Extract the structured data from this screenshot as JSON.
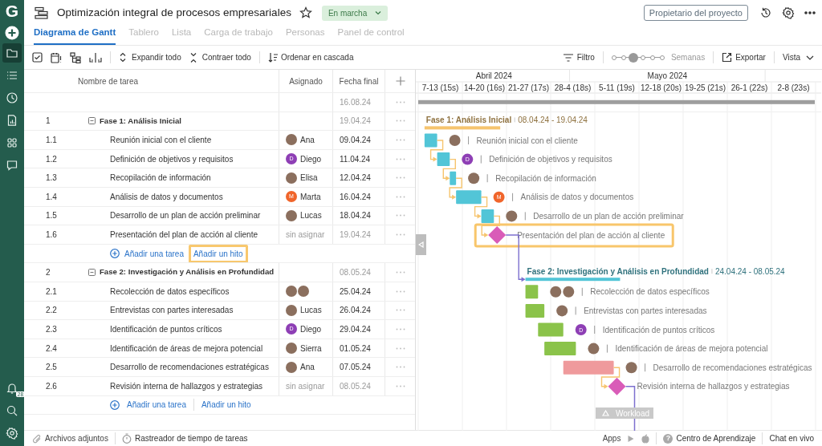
{
  "sidebar": {
    "logo": "G",
    "items": [
      {
        "kind": "folder",
        "selected": true
      },
      {
        "kind": "list",
        "selected": false
      },
      {
        "kind": "clock",
        "selected": false
      },
      {
        "kind": "report",
        "selected": false
      },
      {
        "kind": "grid",
        "selected": false
      },
      {
        "kind": "chat",
        "selected": false
      }
    ],
    "notification_count": "28"
  },
  "project": {
    "title": "Optimización integral de procesos empresariales",
    "starred": false,
    "status": "En marcha",
    "owner_button": "Propietario del proyecto"
  },
  "tabs": [
    {
      "label": "Diagrama de Gantt",
      "selected": true
    },
    {
      "label": "Tablero",
      "selected": false
    },
    {
      "label": "Lista",
      "selected": false
    },
    {
      "label": "Carga de trabajo",
      "selected": false
    },
    {
      "label": "Personas",
      "selected": false
    },
    {
      "label": "Panel de control",
      "selected": false
    }
  ],
  "toolbar": {
    "actions": [
      {
        "kind": "expand",
        "label": "Expandir todo"
      },
      {
        "kind": "collapse",
        "label": "Contraer todo"
      },
      {
        "kind": "sort",
        "label": "Ordenar en cascada"
      }
    ],
    "filter": "Filtro",
    "zoom": {
      "level": 0.4,
      "label": "Semanas"
    },
    "export": "Exportar",
    "view": "Vista"
  },
  "table": {
    "columns": [
      "Nombre de tarea",
      "Asignado",
      "Fecha final"
    ],
    "rows": [
      {
        "kind": "total",
        "due": "16.08.24"
      },
      {
        "kind": "phase",
        "number": "1",
        "name": "Fase 1: Análisis Inicial",
        "expanded": true,
        "due": "19.04.24"
      },
      {
        "kind": "task",
        "number": "1.1",
        "name": "Reunión inicial con el cliente",
        "assignees": [
          {
            "kind": "photo",
            "name": "Ana"
          }
        ],
        "due": "09.04.24"
      },
      {
        "kind": "task",
        "number": "1.2",
        "name": "Definición de objetivos y requisitos",
        "assignees": [
          {
            "kind": "initial",
            "initial": "D",
            "color": "#8e3fb5",
            "name": "Diego"
          }
        ],
        "due": "11.04.24"
      },
      {
        "kind": "task",
        "number": "1.3",
        "name": "Recopilación de información",
        "assignees": [
          {
            "kind": "photo",
            "name": "Elisa"
          }
        ],
        "due": "12.04.24"
      },
      {
        "kind": "task",
        "number": "1.4",
        "name": "Análisis de datos y documentos",
        "assignees": [
          {
            "kind": "initial",
            "initial": "M",
            "color": "#f0652b",
            "name": "Marta"
          }
        ],
        "due": "16.04.24"
      },
      {
        "kind": "task",
        "number": "1.5",
        "name": "Desarrollo de un plan de acción preliminar",
        "assignees": [
          {
            "kind": "photo",
            "name": "Lucas"
          }
        ],
        "due": "18.04.24"
      },
      {
        "kind": "milestone",
        "number": "1.6",
        "name": "Presentación del plan de acción al cliente",
        "unassigned": "sin asignar",
        "due": "19.04.24"
      },
      {
        "kind": "add",
        "add_task": "Añadir una tarea",
        "add_milestone": "Añadir un hito",
        "highlighted": true
      },
      {
        "kind": "phase",
        "number": "2",
        "name": "Fase 2: Investigación y Análisis en Profundidad",
        "expanded": true,
        "due": "08.05.24"
      },
      {
        "kind": "task",
        "number": "2.1",
        "name": "Recolección de datos específicos",
        "assignees": [
          {
            "kind": "photo"
          },
          {
            "kind": "photo"
          }
        ],
        "due": "25.04.24"
      },
      {
        "kind": "task",
        "number": "2.2",
        "name": "Entrevistas con partes interesadas",
        "assignees": [
          {
            "kind": "photo",
            "name": "Lucas"
          }
        ],
        "due": "26.04.24"
      },
      {
        "kind": "task",
        "number": "2.3",
        "name": "Identificación de puntos críticos",
        "assignees": [
          {
            "kind": "initial",
            "initial": "D",
            "color": "#8e3fb5",
            "name": "Diego"
          }
        ],
        "due": "29.04.24"
      },
      {
        "kind": "task",
        "number": "2.4",
        "name": "Identificación de áreas de mejora potencial",
        "assignees": [
          {
            "kind": "photo",
            "name": "Sierra"
          }
        ],
        "due": "01.05.24"
      },
      {
        "kind": "task",
        "number": "2.5",
        "name": "Desarrollo de recomendaciones estratégicas",
        "assignees": [
          {
            "kind": "photo",
            "name": "Ana"
          }
        ],
        "due": "07.05.24"
      },
      {
        "kind": "milestone",
        "number": "2.6",
        "name": "Revisión interna de hallazgos y estrategias",
        "unassigned": "sin asignar",
        "due": "08.05.24"
      },
      {
        "kind": "add",
        "add_task": "Añadir una tarea",
        "add_milestone": "Añadir un hito",
        "highlighted": false
      }
    ]
  },
  "gantt": {
    "months": [
      "Abril 2024",
      "Mayo 2024"
    ],
    "weeks": [
      "7-13 (15s)",
      "14-20 (16s)",
      "21-27 (17s)",
      "28-4 (18s)",
      "5-11 (19s)",
      "12-18 (20s)",
      "19-25 (21s)",
      "26-1 (22s)",
      "2-8 (23s)"
    ],
    "items": [
      {
        "kind": "project"
      },
      {
        "kind": "phase",
        "label": "Fase 1: Análisis Inicial",
        "range": "08.04.24 - 19.04.24",
        "color": "#f6c46e",
        "linked": false
      },
      {
        "kind": "task",
        "label": "Reunión inicial con el cliente",
        "color": "#52c5d7",
        "avatars": [
          {
            "kind": "photo"
          }
        ],
        "linked": false
      },
      {
        "kind": "task",
        "label": "Definición de objetivos y requisitos",
        "color": "#52c5d7",
        "avatars": [
          {
            "kind": "initial",
            "initial": "D",
            "color": "#8e3fb5"
          }
        ],
        "linked": true
      },
      {
        "kind": "task",
        "label": "Recopilación de información",
        "color": "#52c5d7",
        "avatars": [
          {
            "kind": "photo"
          }
        ],
        "linked": true
      },
      {
        "kind": "task",
        "label": "Análisis de datos y documentos",
        "color": "#52c5d7",
        "avatars": [
          {
            "kind": "initial",
            "initial": "M",
            "color": "#f0652b"
          }
        ],
        "linked": true
      },
      {
        "kind": "task",
        "label": "Desarrollo de un plan de acción preliminar",
        "color": "#52c5d7",
        "avatars": [
          {
            "kind": "photo"
          }
        ],
        "linked": true
      },
      {
        "kind": "milestone",
        "label": "Presentación del plan de acción al cliente",
        "color": "#d95cb8",
        "linked": true,
        "highlighted": true,
        "continues": false
      },
      {
        "kind": "gap"
      },
      {
        "kind": "phase",
        "label": "Fase 2: Investigación y Análisis en Profundidad",
        "range": "24.04.24 - 08.05.24",
        "color": "#52c5d7",
        "linked": true
      },
      {
        "kind": "task",
        "label": "Recolección de datos específicos",
        "color": "#8bc34a",
        "avatars": [
          {
            "kind": "photo"
          },
          {
            "kind": "photo"
          }
        ],
        "linked": false
      },
      {
        "kind": "task",
        "label": "Entrevistas con partes interesadas",
        "color": "#8bc34a",
        "avatars": [
          {
            "kind": "photo"
          }
        ],
        "linked": false
      },
      {
        "kind": "task",
        "label": "Identificación de puntos críticos",
        "color": "#8bc34a",
        "avatars": [
          {
            "kind": "initial",
            "initial": "D",
            "color": "#8e3fb5"
          }
        ],
        "linked": false
      },
      {
        "kind": "task",
        "label": "Identificación de áreas de mejora potencial",
        "color": "#8bc34a",
        "avatars": [
          {
            "kind": "photo"
          }
        ],
        "linked": false
      },
      {
        "kind": "task",
        "label": "Desarrollo de recomendaciones estratégicas",
        "color": "#ef9a9c",
        "avatars": [
          {
            "kind": "photo"
          }
        ],
        "linked": false
      },
      {
        "kind": "milestone",
        "label": "Revisión interna de hallazgos y estrategias",
        "color": "#d95cb8",
        "linked": true,
        "highlighted": false,
        "continues": true
      },
      {
        "kind": "gap"
      }
    ],
    "workload_tab": "Workload"
  },
  "footer": {
    "attachments": "Archivos adjuntos",
    "time_tracker": "Rastreador de tiempo de tareas",
    "apps": "Apps",
    "help_glyph": "?",
    "help": "Centro de Aprendizaje",
    "chat": "Chat en vivo"
  }
}
